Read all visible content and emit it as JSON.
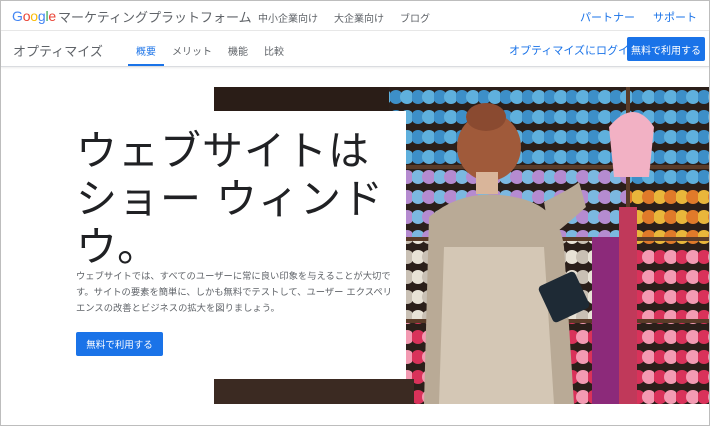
{
  "topbar": {
    "logo": [
      "G",
      "o",
      "o",
      "g",
      "l",
      "e"
    ],
    "brand_sub": "マーケティングプラットフォーム",
    "nav": [
      "中小企業向け",
      "大企業向け",
      "ブログ"
    ],
    "links": [
      "パートナー",
      "サポート"
    ]
  },
  "product_bar": {
    "name": "オプティマイズ",
    "tabs": [
      "概要",
      "メリット",
      "機能",
      "比較"
    ],
    "active_tab": "概要",
    "login_label": "オプティマイズにログイン",
    "cta_label": "無料で利用する"
  },
  "hero": {
    "headline": "ウェブサイトは\nショー ウィンド\nウ。",
    "description": "ウェブサイトでは、すべてのユーザーに常に良い印象を与えることが大切です。サイトの要素を簡単に、しかも無料でテストして、ユーザー エクスペリエンスの改善とビジネスの拡大を図りましょう。",
    "cta_label": "無料で利用する",
    "photo_icon": "yarn-shop-photo"
  },
  "colors": {
    "accent": "#1a73e8",
    "text_dark": "#202124",
    "text_muted": "#5f6368"
  }
}
